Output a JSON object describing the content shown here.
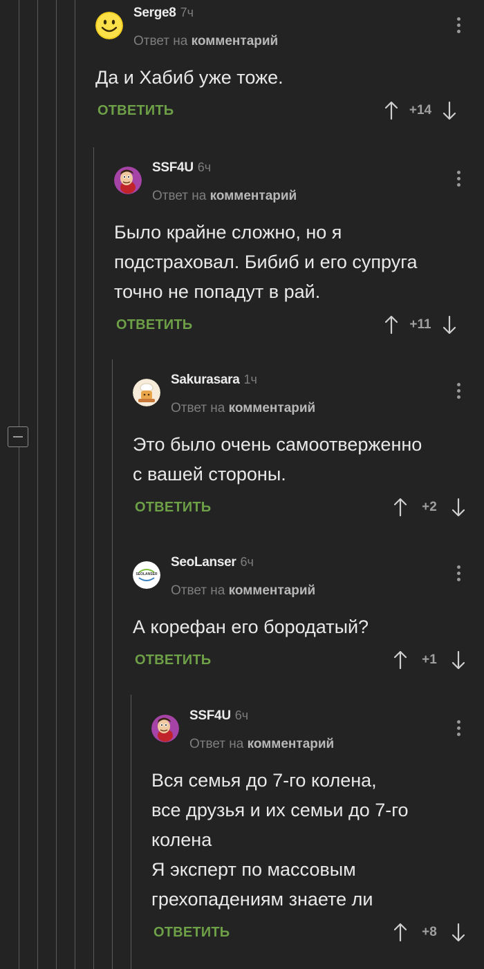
{
  "comments": [
    {
      "author": "Serge8",
      "time": "7ч",
      "reply_prefix": "Ответ на",
      "reply_link": "комментарий",
      "text": "Да и Хабиб уже тоже.",
      "reply_label": "ОТВЕТИТЬ",
      "rating": "+14",
      "avatar": "smiley-avatar-icon"
    },
    {
      "author": "SSF4U",
      "time": "6ч",
      "reply_prefix": "Ответ на",
      "reply_link": "комментарий",
      "text": "Было крайне сложно, но я\nподстраховал. Бибиб и его супруга\nточно не попадут в рай.",
      "reply_label": "ОТВЕТИТЬ",
      "rating": "+11",
      "avatar": "cartoon-character-avatar-icon"
    },
    {
      "author": "Sakurasara",
      "time": "1ч",
      "reply_prefix": "Ответ на",
      "reply_link": "комментарий",
      "text": "Это было очень самоотверженно\nс вашей стороны.",
      "reply_label": "ОТВЕТИТЬ",
      "rating": "+2",
      "avatar": "chef-character-avatar-icon"
    },
    {
      "author": "SeoLanser",
      "time": "6ч",
      "reply_prefix": "Ответ на",
      "reply_link": "комментарий",
      "text": "А корефан его бородатый?",
      "reply_label": "ОТВЕТИТЬ",
      "rating": "+1",
      "avatar": "seolanser-logo-avatar",
      "avatar_logo_text": "SEOLANSER"
    },
    {
      "author": "SSF4U",
      "time": "6ч",
      "reply_prefix": "Ответ на",
      "reply_link": "комментарий",
      "text": "Вся семья до 7-го колена,\nвсе друзья и их семьи до 7-го\nколена\nЯ эксперт по массовым\nгрехопадениям знаете ли",
      "reply_label": "ОТВЕТИТЬ",
      "rating": "+8",
      "avatar": "cartoon-character-avatar-icon"
    }
  ],
  "colors": {
    "background": "#232323",
    "reply_action": "#6ea047",
    "thread_line": "#5a5a5a"
  }
}
